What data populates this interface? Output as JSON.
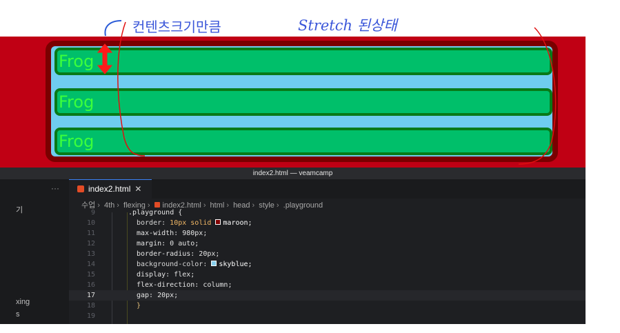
{
  "annotations": {
    "left_note": "컨텐츠크기만큼",
    "right_note": "Stretch 된상태"
  },
  "preview": {
    "items": [
      "Frog",
      "Frog",
      "Frog"
    ]
  },
  "window": {
    "title": "index2.html — veamcamp"
  },
  "sidebar": {
    "more": "···",
    "items": [
      "기",
      "xing",
      "s"
    ]
  },
  "tab": {
    "label": "index2.html",
    "close": "✕"
  },
  "breadcrumb": [
    "수업",
    "4th",
    "flexing",
    "index2.html",
    "html",
    "head",
    "style",
    ".playground"
  ],
  "code": {
    "current_line": 17,
    "lines": [
      {
        "num": "9",
        "text": ".playground {"
      },
      {
        "num": "10",
        "text": "border: 10px solid maroon;"
      },
      {
        "num": "11",
        "text": "max-width: 980px;"
      },
      {
        "num": "12",
        "text": "margin: 0 auto;"
      },
      {
        "num": "13",
        "text": "border-radius: 20px;"
      },
      {
        "num": "14",
        "text": "background-color: skyblue;"
      },
      {
        "num": "15",
        "text": "display: flex;"
      },
      {
        "num": "16",
        "text": "flex-direction: column;"
      },
      {
        "num": "17",
        "text": "gap: 20px;"
      },
      {
        "num": "18",
        "text": "}"
      },
      {
        "num": "19",
        "text": ""
      }
    ]
  },
  "colors": {
    "preview_bg": "#c00014",
    "playground_bg": "#6fcdef",
    "playground_border": "#7a0000",
    "item_bg": "#00bf6a",
    "item_text": "#3cff3c",
    "pen": "#e01010",
    "blue_pen": "#2a5bd7"
  }
}
